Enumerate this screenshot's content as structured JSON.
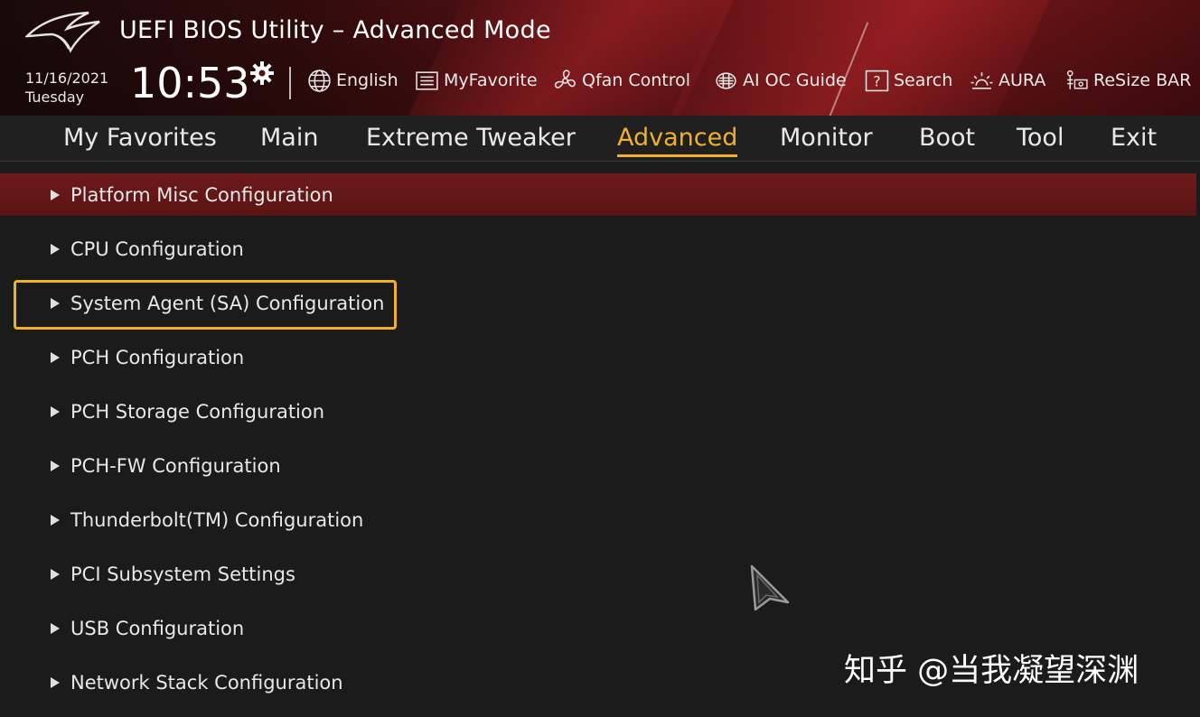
{
  "header": {
    "title": "UEFI BIOS Utility – Advanced Mode",
    "date": "11/16/2021",
    "day": "Tuesday",
    "time": "10:53",
    "tools": [
      {
        "label": "English",
        "icon": "globe-icon"
      },
      {
        "label": "MyFavorite",
        "icon": "favorite-list-icon"
      },
      {
        "label": "Qfan Control",
        "icon": "fan-icon"
      },
      {
        "label": "AI OC Guide",
        "icon": "ai-chip-icon"
      },
      {
        "label": "Search",
        "icon": "question-box-icon"
      },
      {
        "label": "AURA",
        "icon": "aura-light-icon"
      },
      {
        "label": "ReSize BAR",
        "icon": "resize-bar-icon"
      }
    ]
  },
  "menu": {
    "items": [
      "My Favorites",
      "Main",
      "Extreme Tweaker",
      "Advanced",
      "Monitor",
      "Boot",
      "Tool",
      "Exit"
    ],
    "active": "Advanced"
  },
  "content": {
    "items": [
      "Platform Misc Configuration",
      "CPU Configuration",
      "System Agent (SA) Configuration",
      "PCH Configuration",
      "PCH Storage Configuration",
      "PCH-FW Configuration",
      "Thunderbolt(TM) Configuration",
      "PCI Subsystem Settings",
      "USB Configuration",
      "Network Stack Configuration"
    ],
    "selected_index": 0,
    "outlined_index": 2
  },
  "watermark": "知乎 @当我凝望深渊",
  "colors": {
    "accent": "#f2b02a",
    "selected_row": "#6d1a1a",
    "header_red": "#8a1a1e",
    "background": "#1b1b1b"
  }
}
